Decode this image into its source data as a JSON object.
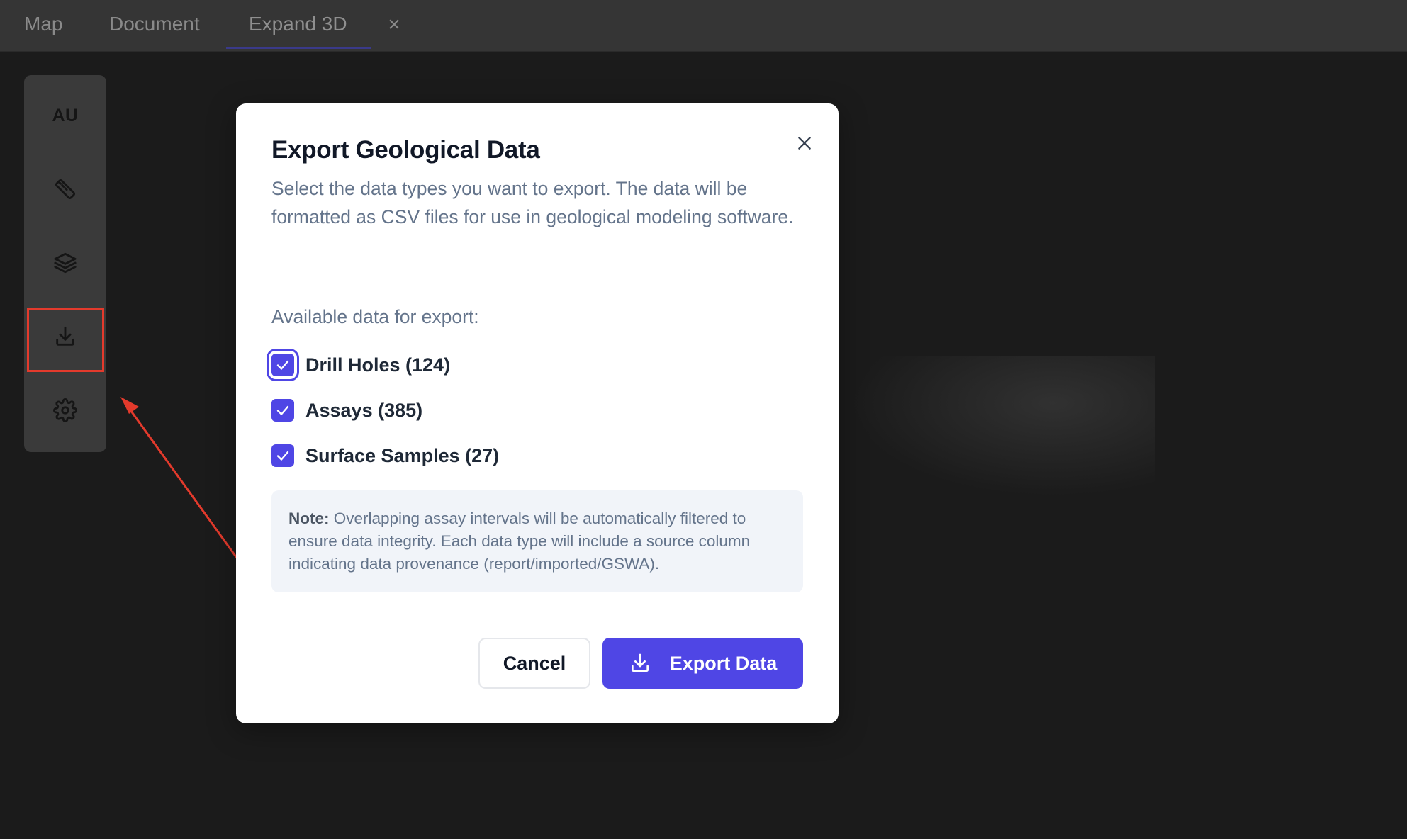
{
  "tabs": [
    {
      "label": "Map"
    },
    {
      "label": "Document"
    },
    {
      "label": "Expand 3D",
      "active": true
    }
  ],
  "tab_close_glyph": "×",
  "toolbar": {
    "items": [
      {
        "name": "au",
        "label": "AU"
      },
      {
        "name": "ruler-icon"
      },
      {
        "name": "layers-icon"
      },
      {
        "name": "download-icon",
        "highlighted": true
      },
      {
        "name": "gear-icon"
      }
    ]
  },
  "dialog": {
    "title": "Export Geological Data",
    "description": "Select the data types you want to export. The data will be formatted as CSV files for use in geological modeling software.",
    "available_label": "Available data for export:",
    "options": [
      {
        "label": "Drill Holes (124)",
        "checked": true
      },
      {
        "label": "Assays (385)",
        "checked": true
      },
      {
        "label": "Surface Samples (27)",
        "checked": true
      }
    ],
    "note_prefix": "Note:",
    "note_text": " Overlapping assay intervals will be automatically filtered to ensure data integrity. Each data type will include a source column indicating data provenance (report/imported/GSWA).",
    "cancel_label": "Cancel",
    "export_label": "Export Data"
  },
  "colors": {
    "accent": "#4f46e5",
    "annotation": "#e33a2c"
  }
}
